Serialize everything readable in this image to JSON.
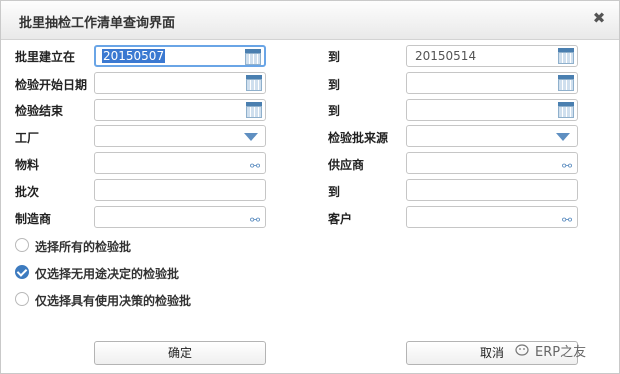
{
  "window": {
    "title": "批里抽检工作清单查询界面"
  },
  "fields": {
    "batch_created_label": "批里建立在",
    "batch_created_from": "20150507",
    "batch_created_to_label": "到",
    "batch_created_to": "20150514",
    "insp_start_label": "检验开始日期",
    "insp_start_to_label": "到",
    "insp_end_label": "检验结束",
    "insp_end_to_label": "到",
    "plant_label": "工厂",
    "batch_source_label": "检验批来源",
    "material_label": "物料",
    "supplier_label": "供应商",
    "lot_label": "批次",
    "lot_to_label": "到",
    "manufacturer_label": "制造商",
    "customer_label": "客户"
  },
  "options": [
    {
      "label": "选择所有的检验批",
      "selected": false
    },
    {
      "label": "仅选择无用途决定的检验批",
      "selected": true
    },
    {
      "label": "仅选择具有使用决策的检验批",
      "selected": false
    }
  ],
  "buttons": {
    "ok": "确定",
    "cancel": "取消"
  },
  "watermark": "ERP之友",
  "accent": "#3d7bbf"
}
